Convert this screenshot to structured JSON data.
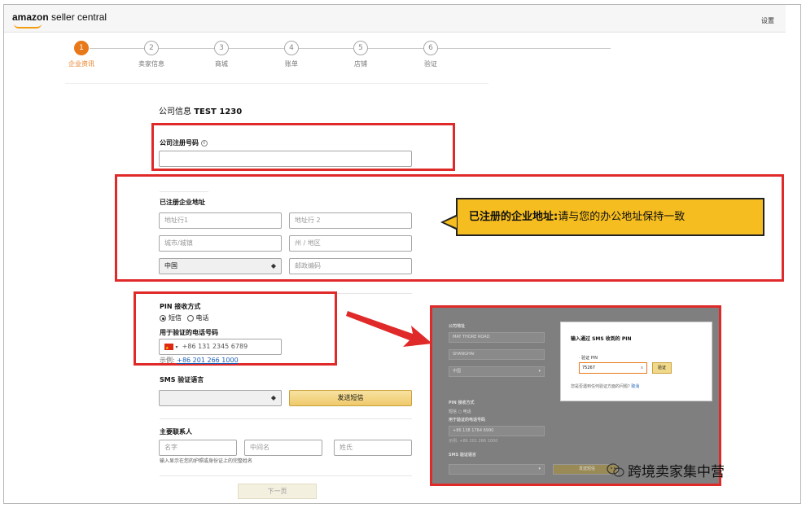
{
  "header": {
    "logo_brand": "amazon",
    "logo_product": "seller central",
    "settings": "设置"
  },
  "steps": [
    {
      "num": "1",
      "label": "企业资讯",
      "active": true
    },
    {
      "num": "2",
      "label": "卖家信息",
      "active": false
    },
    {
      "num": "3",
      "label": "商城",
      "active": false
    },
    {
      "num": "4",
      "label": "账单",
      "active": false
    },
    {
      "num": "5",
      "label": "店铺",
      "active": false
    },
    {
      "num": "6",
      "label": "验证",
      "active": false
    }
  ],
  "form": {
    "title_prefix": "公司信息",
    "title_company": "TEST 1230",
    "reg_number_label": "公司注册号码",
    "reg_number_value": "",
    "address_label": "已注册企业地址",
    "address_line1": "地址行1",
    "address_line2": "地址行 2",
    "city": "城市/城镇",
    "state": "州 / 地区",
    "country": "中国",
    "postal": "邮政编码",
    "pin_method_label": "PIN 接收方式",
    "pin_sms": "短信",
    "pin_phone": "电话",
    "phone_label": "用于验证的电话号码",
    "phone_value": "+86 131 2345 6789",
    "example_prefix": "示例:",
    "example_number": "+86 201 266 1000",
    "sms_lang_label": "SMS 验证语言",
    "sms_lang_value": "",
    "send_sms": "发送短信",
    "contact_label": "主要联系人",
    "first_name": "名字",
    "middle_name": "中间名",
    "last_name": "姓氏",
    "contact_hint": "输入显示在您的护照或身份证上的完整姓名",
    "next": "下一页"
  },
  "callout": {
    "bold": "已注册的企业地址:",
    "text": "请与您的办公地址保持一致"
  },
  "modal_shot": {
    "bg_labels": [
      "公司地址",
      "PIN 接收方式",
      "用于验证的电话号码",
      "SMS 验证语言"
    ],
    "bg_address1": "MAY THORE ROAD",
    "bg_city": "SHANGHAI",
    "bg_country": "中国",
    "bg_pin_sms": "短信",
    "bg_pin_phone": "电话",
    "bg_phone": "+86 138 1764 6990",
    "bg_example": "示例: +86 201 266 1000",
    "bg_send": "发送短信",
    "dialog_title": "输入通过 SMS 收到的 PIN",
    "pin_label": "· 验证 PIN",
    "pin_value": "75267",
    "pin_clear": "x",
    "verify": "验证",
    "footer_text": "您是否遇到任何验证方面的问题?",
    "footer_link": "取消"
  },
  "watermark": "跨境卖家集中营"
}
